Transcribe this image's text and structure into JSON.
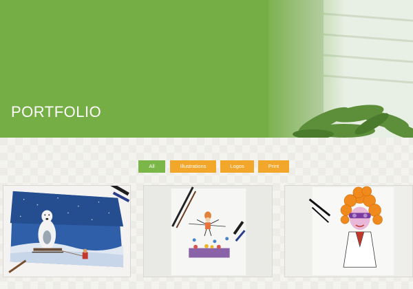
{
  "hero": {
    "title": "PORTFOLIO",
    "background_color": "#76ae46"
  },
  "filters": [
    {
      "label": "All",
      "active": true,
      "color": "#7ab648"
    },
    {
      "label": "Illustrations",
      "active": false,
      "color": "#f2a62a"
    },
    {
      "label": "Logos",
      "active": false,
      "color": "#f2a62a"
    },
    {
      "label": "Print",
      "active": false,
      "color": "#f2a62a"
    }
  ],
  "portfolio": {
    "items": [
      {
        "subject": "polar bear on sled watercolor illustration"
      },
      {
        "subject": "tightrope acrobat ink illustration"
      },
      {
        "subject": "curly-haired woman with glasses ink drawing"
      }
    ]
  }
}
